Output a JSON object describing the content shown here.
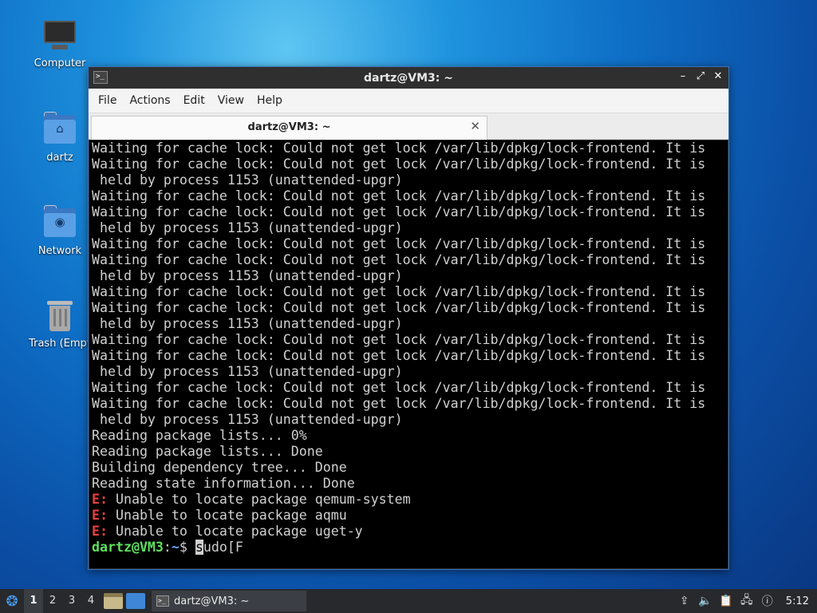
{
  "desktop": {
    "icons": [
      {
        "label": "Computer",
        "icon": "computer-icon"
      },
      {
        "label": "dartz",
        "icon": "home-folder-icon"
      },
      {
        "label": "Network",
        "icon": "network-folder-icon"
      },
      {
        "label": "Trash (Empt",
        "icon": "trash-icon"
      }
    ]
  },
  "window": {
    "title": "dartz@VM3: ~",
    "menu": [
      "File",
      "Actions",
      "Edit",
      "View",
      "Help"
    ],
    "tab_title": "dartz@VM3: ~",
    "controls": {
      "minimize": "–",
      "maximize": "⤢",
      "close": "✕"
    }
  },
  "terminal": {
    "lines": [
      "Waiting for cache lock: Could not get lock /var/lib/dpkg/lock-frontend. It is",
      "Waiting for cache lock: Could not get lock /var/lib/dpkg/lock-frontend. It is",
      " held by process 1153 (unattended-upgr)",
      "Waiting for cache lock: Could not get lock /var/lib/dpkg/lock-frontend. It is",
      "Waiting for cache lock: Could not get lock /var/lib/dpkg/lock-frontend. It is",
      " held by process 1153 (unattended-upgr)",
      "Waiting for cache lock: Could not get lock /var/lib/dpkg/lock-frontend. It is",
      "Waiting for cache lock: Could not get lock /var/lib/dpkg/lock-frontend. It is",
      " held by process 1153 (unattended-upgr)",
      "Waiting for cache lock: Could not get lock /var/lib/dpkg/lock-frontend. It is",
      "Waiting for cache lock: Could not get lock /var/lib/dpkg/lock-frontend. It is",
      " held by process 1153 (unattended-upgr)",
      "Waiting for cache lock: Could not get lock /var/lib/dpkg/lock-frontend. It is",
      "Waiting for cache lock: Could not get lock /var/lib/dpkg/lock-frontend. It is",
      " held by process 1153 (unattended-upgr)",
      "Waiting for cache lock: Could not get lock /var/lib/dpkg/lock-frontend. It is",
      "Waiting for cache lock: Could not get lock /var/lib/dpkg/lock-frontend. It is",
      " held by process 1153 (unattended-upgr)",
      "Reading package lists... 0%",
      "Reading package lists... Done",
      "Building dependency tree... Done",
      "Reading state information... Done"
    ],
    "error_prefix": "E:",
    "errors": [
      " Unable to locate package qemum-system",
      " Unable to locate package aqmu",
      " Unable to locate package uget-y"
    ],
    "prompt_user": "dartz@VM3",
    "prompt_sep": ":",
    "prompt_path": "~",
    "prompt_symbol": "$ ",
    "input_cursor_char": "s",
    "input_rest": "udo[F"
  },
  "taskbar": {
    "workspaces": [
      "1",
      "2",
      "3",
      "4"
    ],
    "active_workspace": "1",
    "task_label": "dartz@VM3: ~",
    "clock": "5:12"
  },
  "colors": {
    "terminal_bg": "#000000",
    "terminal_fg": "#d0d0d0",
    "error": "#e83f3f",
    "prompt_user": "#5ee05e",
    "prompt_path": "#6aa7ff"
  }
}
